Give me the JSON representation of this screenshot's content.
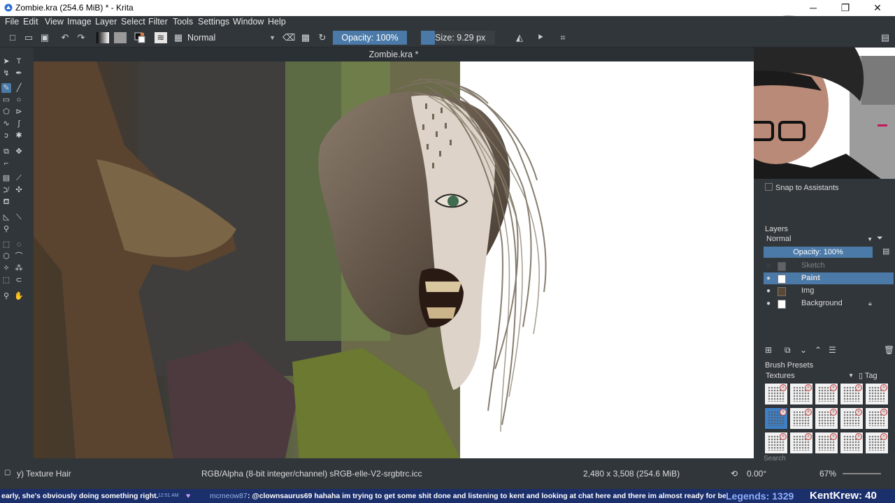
{
  "window": {
    "title": "Zombie.kra (254.6 MiB)  * - Krita",
    "minimize": "─",
    "maximize": "❐",
    "close": "✕"
  },
  "menu": [
    "File",
    "Edit",
    "View",
    "Image",
    "Layer",
    "Select",
    "Filter",
    "Tools",
    "Settings",
    "Window",
    "Help"
  ],
  "toolbar": {
    "blend_mode": "Normal",
    "opacity": "Opacity: 100%",
    "size": "Size: 9.29 px"
  },
  "document": {
    "title": "Zombie.kra *"
  },
  "dockers": {
    "snap_label": "Snap to Assistants",
    "layers": {
      "title": "Layers",
      "blend_mode": "Normal",
      "opacity": "Opacity:  100%",
      "items": [
        {
          "name": "Sketch",
          "visible": false,
          "selected": false,
          "locked": false
        },
        {
          "name": "Paint",
          "visible": true,
          "selected": true,
          "locked": false
        },
        {
          "name": "Img",
          "visible": true,
          "selected": false,
          "locked": false
        },
        {
          "name": "Background",
          "visible": true,
          "selected": false,
          "locked": true
        }
      ]
    },
    "brush_presets": {
      "title": "Brush Presets",
      "tag": "Textures",
      "tag_button": "Tag",
      "search_placeholder": "Search"
    }
  },
  "status": {
    "brush": "y) Texture Hair",
    "color_model": "RGB/Alpha (8-bit integer/channel)  sRGB-elle-V2-srgbtrc.icc",
    "dimensions": "2,480 x 3,508 (254.6 MiB)",
    "rotation": "0.00°",
    "zoom": "67%"
  },
  "ticker": {
    "msg1": "early, she's obviously doing something right.",
    "time": "12:51 AM",
    "user": "mcmeow87",
    "msg2": ": @clownsaurus69 hahaha im trying to get some shit done and listening to kent and looking at chat here and there  im almost ready for bed though",
    "legends": "Legends: 1329",
    "brand": "KentKrew: 40"
  },
  "colors": {
    "accent": "#4b7aa8",
    "panel": "#31363b",
    "ticker_bg": "#1b2f6b"
  }
}
